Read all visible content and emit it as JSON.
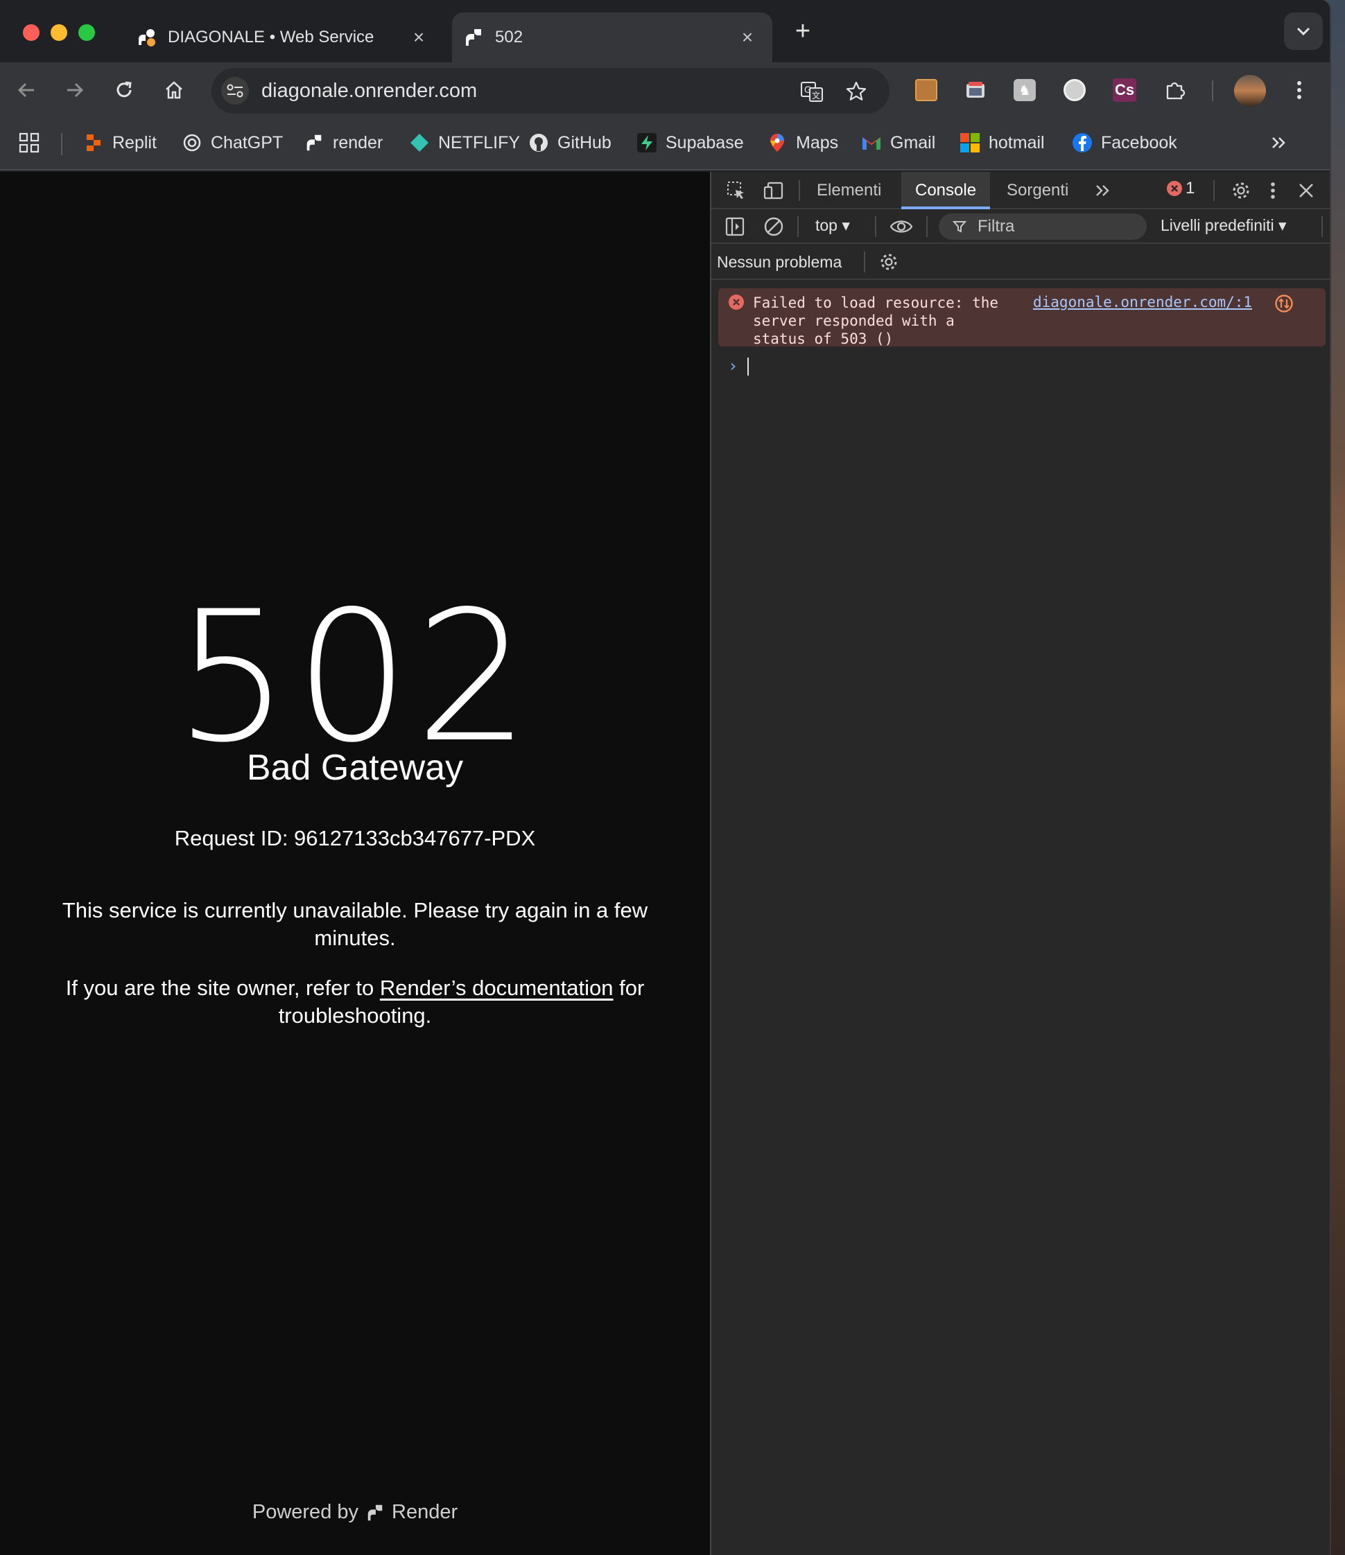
{
  "tabs": [
    {
      "title": "DIAGONALE • Web Service",
      "close": "×"
    },
    {
      "title": "502",
      "close": "×"
    }
  ],
  "new_tab": "+",
  "address_bar": {
    "url": "diagonale.onrender.com"
  },
  "bookmarks": [
    {
      "label": "Replit",
      "icon": "replit-icon"
    },
    {
      "label": "ChatGPT",
      "icon": "chatgpt-icon"
    },
    {
      "label": "render",
      "icon": "render-icon"
    },
    {
      "label": "NETFLIFY",
      "icon": "netlify-icon"
    },
    {
      "label": "GitHub",
      "icon": "github-icon"
    },
    {
      "label": "Supabase",
      "icon": "supabase-icon"
    },
    {
      "label": "Maps",
      "icon": "maps-icon"
    },
    {
      "label": "Gmail",
      "icon": "gmail-icon"
    },
    {
      "label": "hotmail",
      "icon": "microsoft-icon"
    },
    {
      "label": "Facebook",
      "icon": "facebook-icon"
    }
  ],
  "page": {
    "code": "502",
    "title": "Bad Gateway",
    "request_id": "Request ID: 96127133cb347677-PDX",
    "message": "This service is currently unavailable. Please try again in a few minutes.",
    "owner_prefix": "If you are the site owner, refer to ",
    "owner_link": "Render’s documentation",
    "owner_suffix": " for troubleshooting.",
    "powered_by": "Powered by",
    "brand": "Render"
  },
  "devtools": {
    "tabs": [
      "Elementi",
      "Console",
      "Sorgenti"
    ],
    "active_tab": "Console",
    "error_count": "1",
    "context": "top",
    "filter_placeholder": "Filtra",
    "levels": "Livelli predefiniti",
    "issues": "Nessun problema",
    "console_error": "Failed to load resource: the\nserver responded with a\nstatus of 503 ()",
    "console_source": "diagonale.onrender.com/:1",
    "prompt": "›"
  },
  "colors": {
    "page_bg": "#0d0d0d",
    "devtools_bg": "#282828",
    "error_bg": "#4e3534",
    "active_tab_underline": "#7cacf8"
  }
}
